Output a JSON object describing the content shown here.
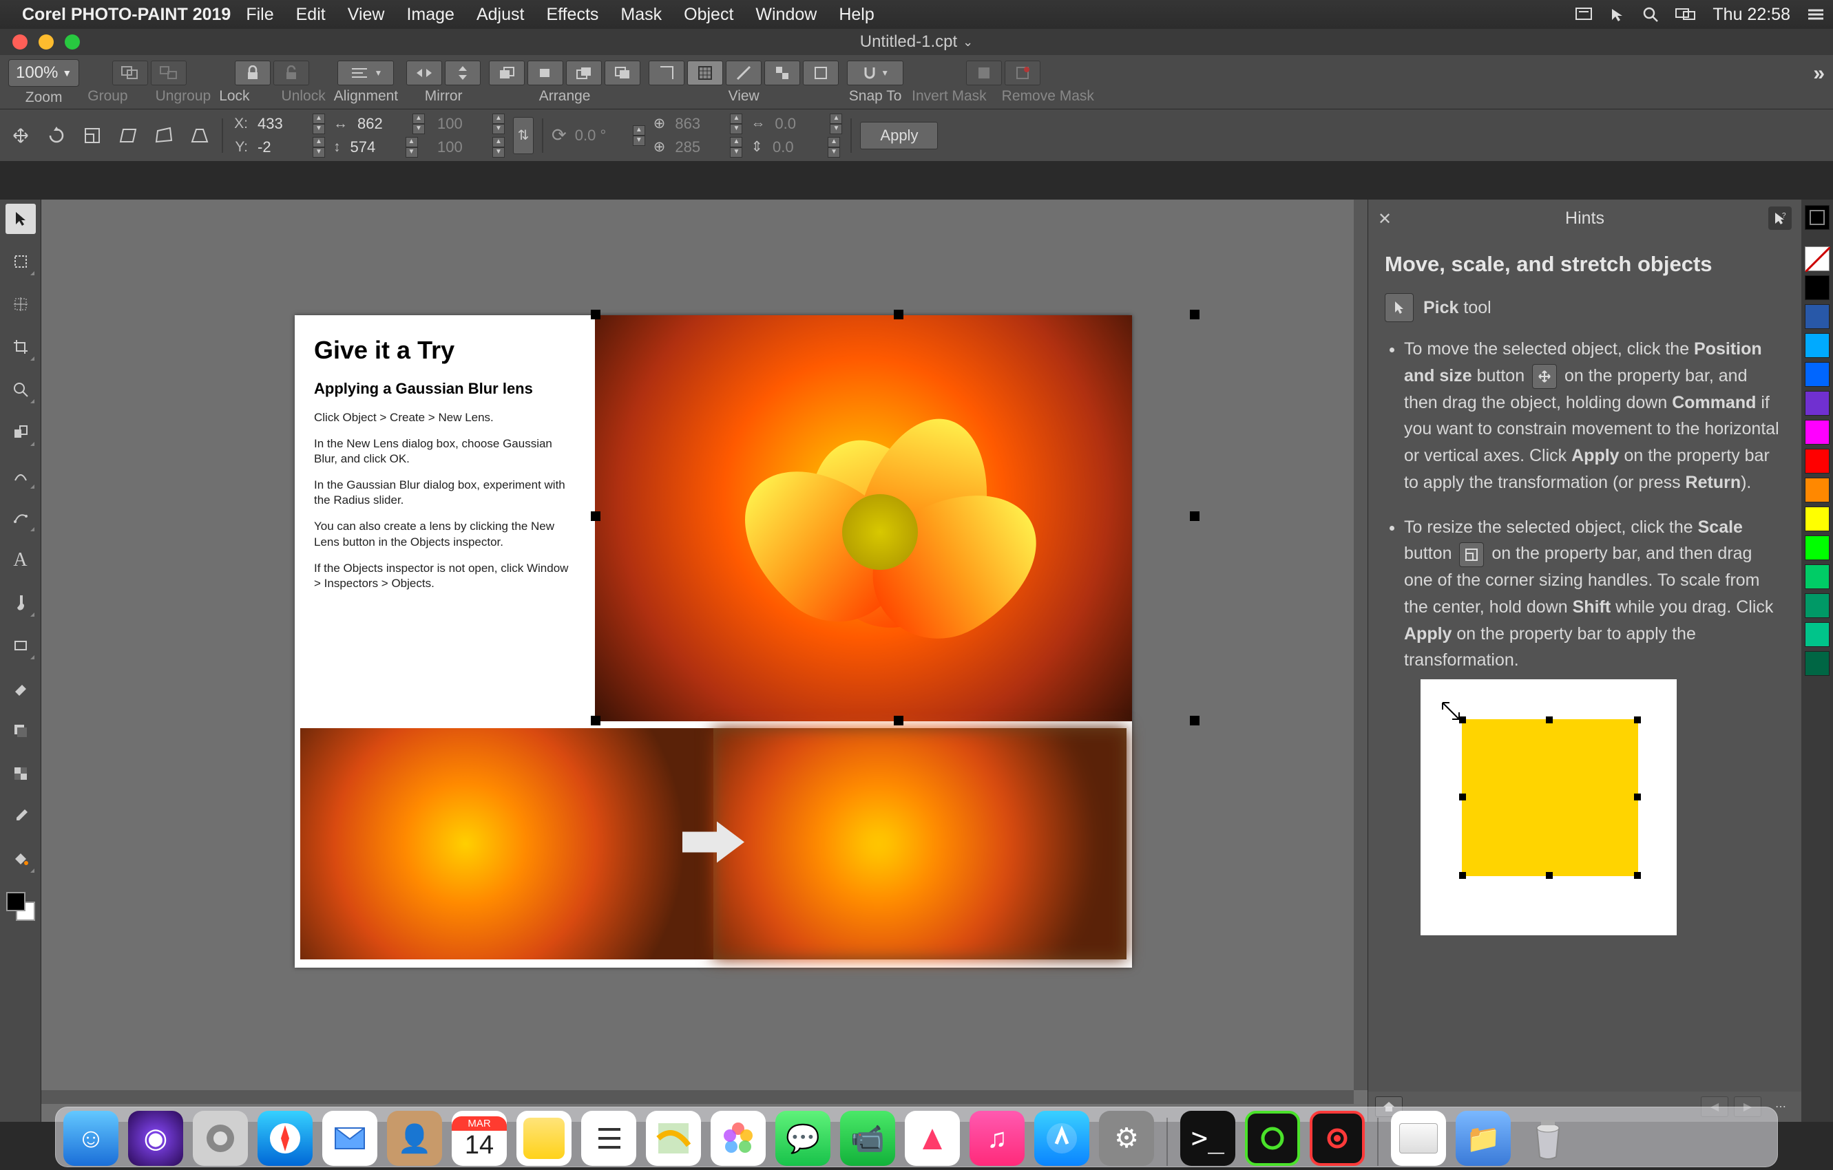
{
  "menubar": {
    "appname": "Corel PHOTO-PAINT 2019",
    "items": [
      "File",
      "Edit",
      "View",
      "Image",
      "Adjust",
      "Effects",
      "Mask",
      "Object",
      "Window",
      "Help"
    ],
    "clock": "Thu 22:58"
  },
  "window": {
    "title": "Untitled-1.cpt"
  },
  "toolbar": {
    "zoom": {
      "value": "100%",
      "label": "Zoom"
    },
    "groups": {
      "group": "Group",
      "ungroup": "Ungroup",
      "lock": "Lock",
      "unlock": "Unlock",
      "alignment": "Alignment",
      "mirror": "Mirror",
      "arrange": "Arrange",
      "view": "View",
      "snapto": "Snap To",
      "invertmask": "Invert Mask",
      "removemask": "Remove Mask"
    }
  },
  "propbar": {
    "pos": {
      "x_label": "X:",
      "x": "433",
      "y_label": "Y:",
      "y": "-2"
    },
    "size": {
      "w": "862",
      "h": "574"
    },
    "scale": {
      "sx": "100",
      "sy": "100"
    },
    "rotation": "0.0 °",
    "center": {
      "cx": "863",
      "cy": "285"
    },
    "skew": {
      "h": "0.0",
      "v": "0.0"
    },
    "apply": "Apply"
  },
  "toolbox": [
    "pick",
    "mask-rect",
    "mask-transform",
    "crop",
    "zoom",
    "clone",
    "red-eye",
    "path",
    "text",
    "brush",
    "rectangle",
    "eraser",
    "dropshadow",
    "transparency",
    "eyedropper",
    "fill"
  ],
  "document": {
    "panel": {
      "title": "Give it a Try",
      "subtitle": "Applying a Gaussian Blur lens",
      "p1": "Click Object > Create > New Lens.",
      "p2": "In the New Lens dialog box, choose Gaussian Blur, and click OK.",
      "p3": "In the Gaussian Blur dialog box, experiment with the Radius slider.",
      "p4": "You can also create a lens by clicking the New Lens button in the Objects inspector.",
      "p5": "If the Objects inspector is not open, click Window > Inspectors > Objects."
    }
  },
  "hints": {
    "title": "Hints",
    "heading": "Move, scale, and stretch objects",
    "picktool_bold": "Pick",
    "picktool_rest": " tool",
    "li1_a": "To move the selected object, click the ",
    "li1_b": "Position and size",
    "li1_c": " button ",
    "li1_d": " on the property bar, and then drag the object, holding down ",
    "li1_e": "Command",
    "li1_f": " if you want to constrain movement to the horizontal or vertical axes. Click ",
    "li1_g": "Apply",
    "li1_h": " on the property bar to apply the transformation (or press ",
    "li1_i": "Return",
    "li1_j": ").",
    "li2_a": "To resize the selected object, click the ",
    "li2_b": "Scale",
    "li2_c": " button ",
    "li2_d": " on the property bar, and then drag one of the corner sizing handles. To scale from the center, hold down ",
    "li2_e": "Shift",
    "li2_f": " while you drag. Click ",
    "li2_g": "Apply",
    "li2_h": " on the property bar to apply the transformation."
  },
  "palette": [
    "#000000",
    "#ffffff",
    "#00a8ff",
    "#0066ff",
    "#0033cc",
    "#ff00ff",
    "#ff0000",
    "#ff8800",
    "#ffff00",
    "#88ff00",
    "#00ff00",
    "#00cc66",
    "#009966",
    "#006644",
    "#444444"
  ],
  "dock": {
    "items": [
      "finder",
      "siri",
      "launchpad",
      "safari",
      "mail",
      "contacts",
      "calendar",
      "notes",
      "reminders",
      "maps",
      "photos",
      "messages",
      "facetime",
      "news",
      "music",
      "appstore",
      "settings"
    ],
    "calendar": {
      "month": "MAR",
      "day": "14"
    },
    "right": [
      "terminal",
      "corel-connect",
      "corel-capture",
      "",
      "folder",
      "trash"
    ]
  }
}
